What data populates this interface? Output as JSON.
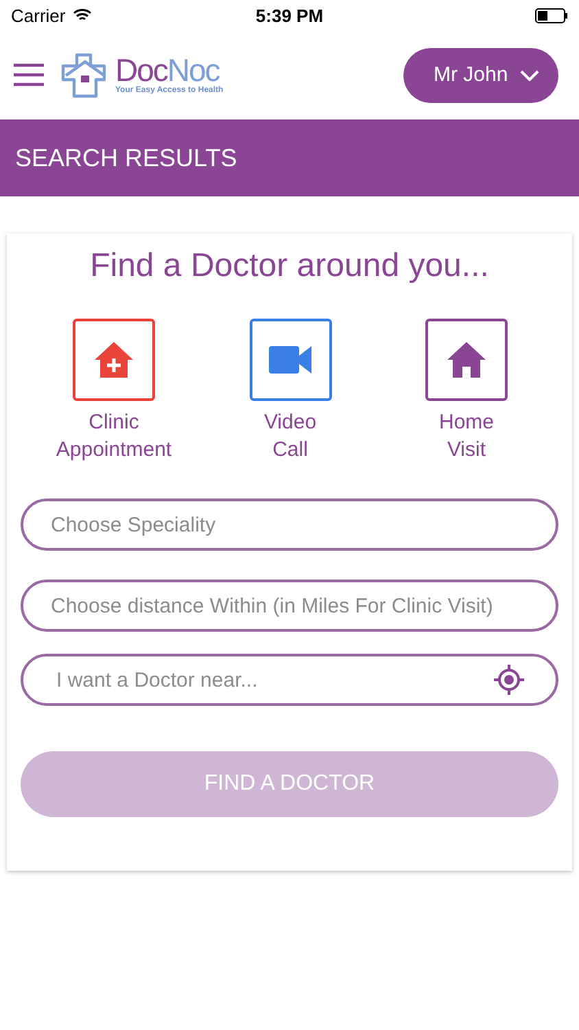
{
  "status_bar": {
    "carrier": "Carrier",
    "time": "5:39 PM"
  },
  "header": {
    "logo": {
      "name_first": "Doc",
      "name_second": "Noc",
      "tagline": "Your Easy Access to Health"
    },
    "user_menu": {
      "label": "Mr John"
    }
  },
  "banner": {
    "title": "SEARCH RESULTS"
  },
  "search_card": {
    "title": "Find a Doctor around you...",
    "options": [
      {
        "kind": "clinic",
        "label_lines": [
          "Clinic",
          "Appointment"
        ],
        "color": "#e8443a"
      },
      {
        "kind": "video",
        "label_lines": [
          "Video",
          "Call"
        ],
        "color": "#3a7ee8"
      },
      {
        "kind": "home",
        "label_lines": [
          "Home",
          "Visit"
        ],
        "color": "#8a4595"
      }
    ],
    "fields": [
      {
        "kind": "select",
        "placeholder": "Choose Speciality"
      },
      {
        "kind": "select",
        "placeholder": "Choose distance Within (in Miles For Clinic Visit)"
      },
      {
        "kind": "location",
        "placeholder": "I want a Doctor near..."
      }
    ],
    "submit": {
      "label": "FIND A DOCTOR",
      "disabled": true
    }
  }
}
